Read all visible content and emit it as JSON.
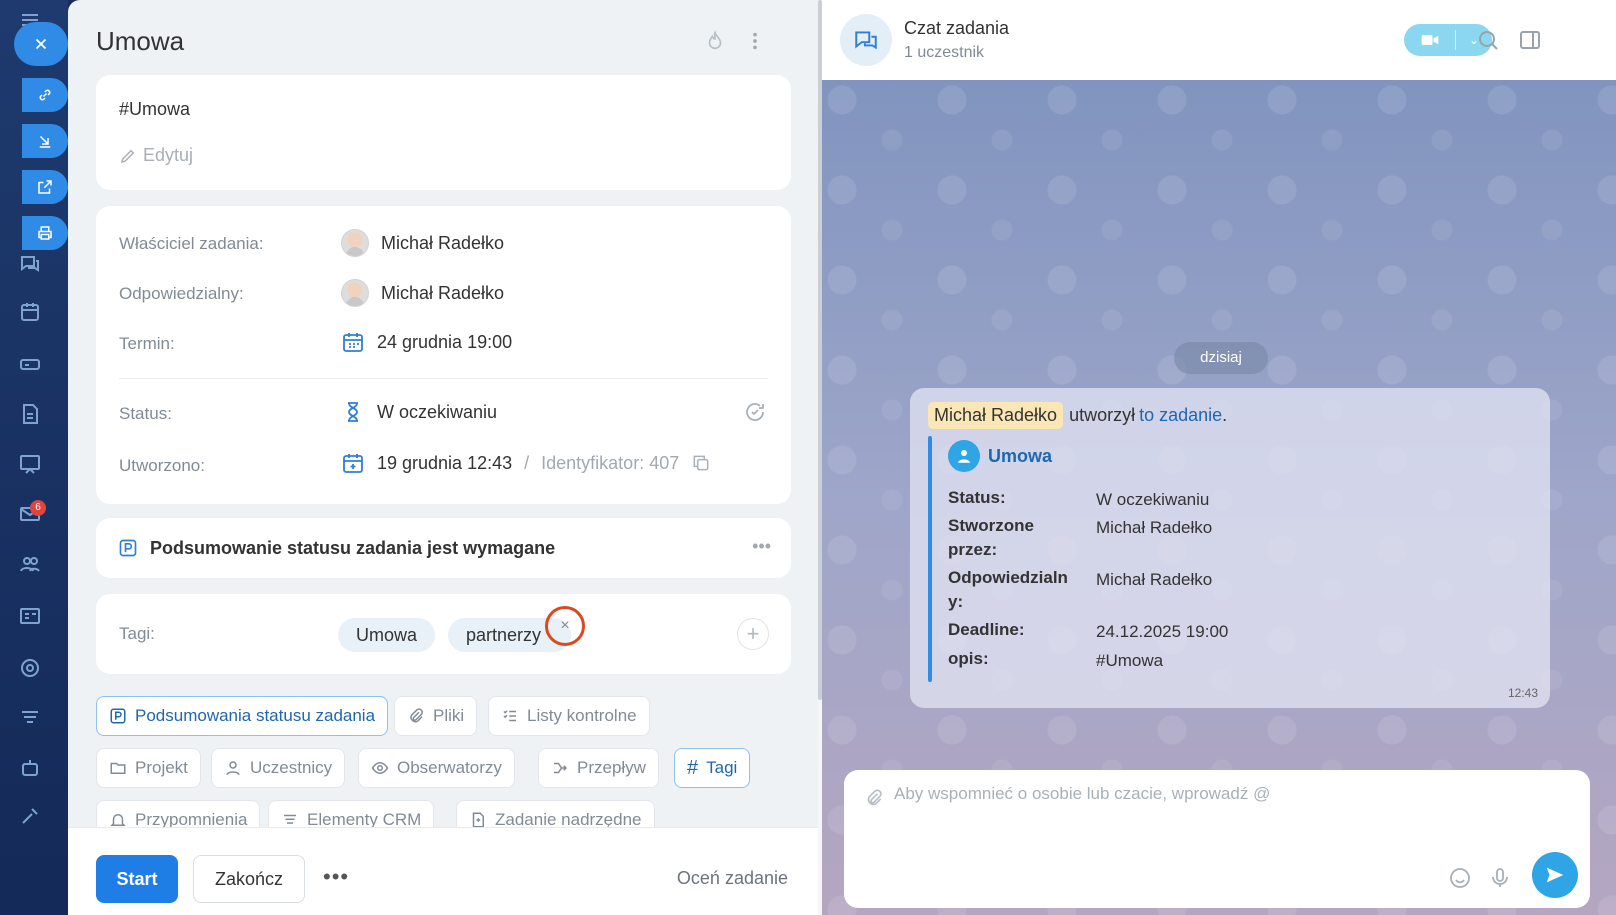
{
  "task": {
    "title": "Umowa",
    "description": "#Umowa",
    "edit_label": "Edytuj",
    "fields": {
      "owner_label": "Właściciel zadania:",
      "owner_value": "Michał Radełko",
      "responsible_label": "Odpowiedzialny:",
      "responsible_value": "Michał Radełko",
      "deadline_label": "Termin:",
      "deadline_value": "24 grudnia 19:00",
      "status_label": "Status:",
      "status_value": "W oczekiwaniu",
      "created_label": "Utworzono:",
      "created_value": "19 grudnia 12:43",
      "id_separator": "/",
      "id_text": "Identyfikator: 407"
    },
    "summary_required": "Podsumowanie statusu zadania jest wymagane",
    "tags": {
      "label": "Tagi:",
      "items": [
        "Umowa",
        "partnerzy"
      ],
      "remove_symbol": "×",
      "add_symbol": "+"
    },
    "chips": [
      "Podsumowania statusu zadania",
      "Pliki",
      "Listy kontrolne",
      "Projekt",
      "Uczestnicy",
      "Obserwatorzy",
      "Przepływ",
      "Tagi",
      "Przypomnienia",
      "Elementy CRM",
      "Zadanie nadrzędne"
    ],
    "footer": {
      "start": "Start",
      "finish": "Zakończ",
      "more": "•••",
      "rate": "Oceń zadanie"
    }
  },
  "sidebar": {
    "badge_count": "6"
  },
  "chat": {
    "title": "Czat zadania",
    "subtitle": "1 uczestnik",
    "date_divider": "dzisiaj",
    "message": {
      "author": "Michał Radełko",
      "action": "utworzył",
      "link_text": "to zadanie",
      "period": ".",
      "card_title": "Umowa",
      "rows": [
        {
          "k": "Status:",
          "v": "W oczekiwaniu"
        },
        {
          "k": "Stworzone przez:",
          "v": "Michał Radełko"
        },
        {
          "k": "Odpowiedzialny:",
          "v": "Michał Radełko"
        },
        {
          "k": "Deadline:",
          "v": "24.12.2025 19:00"
        },
        {
          "k": "opis:",
          "v": "#Umowa"
        }
      ],
      "time": "12:43"
    },
    "input_placeholder": "Aby wspomnieć o osobie lub czacie, wprowadź @"
  },
  "colors": {
    "accent": "#1f7ee6",
    "highlight_ring": "#d94a21",
    "chat_bg": "#8a9cc4"
  }
}
